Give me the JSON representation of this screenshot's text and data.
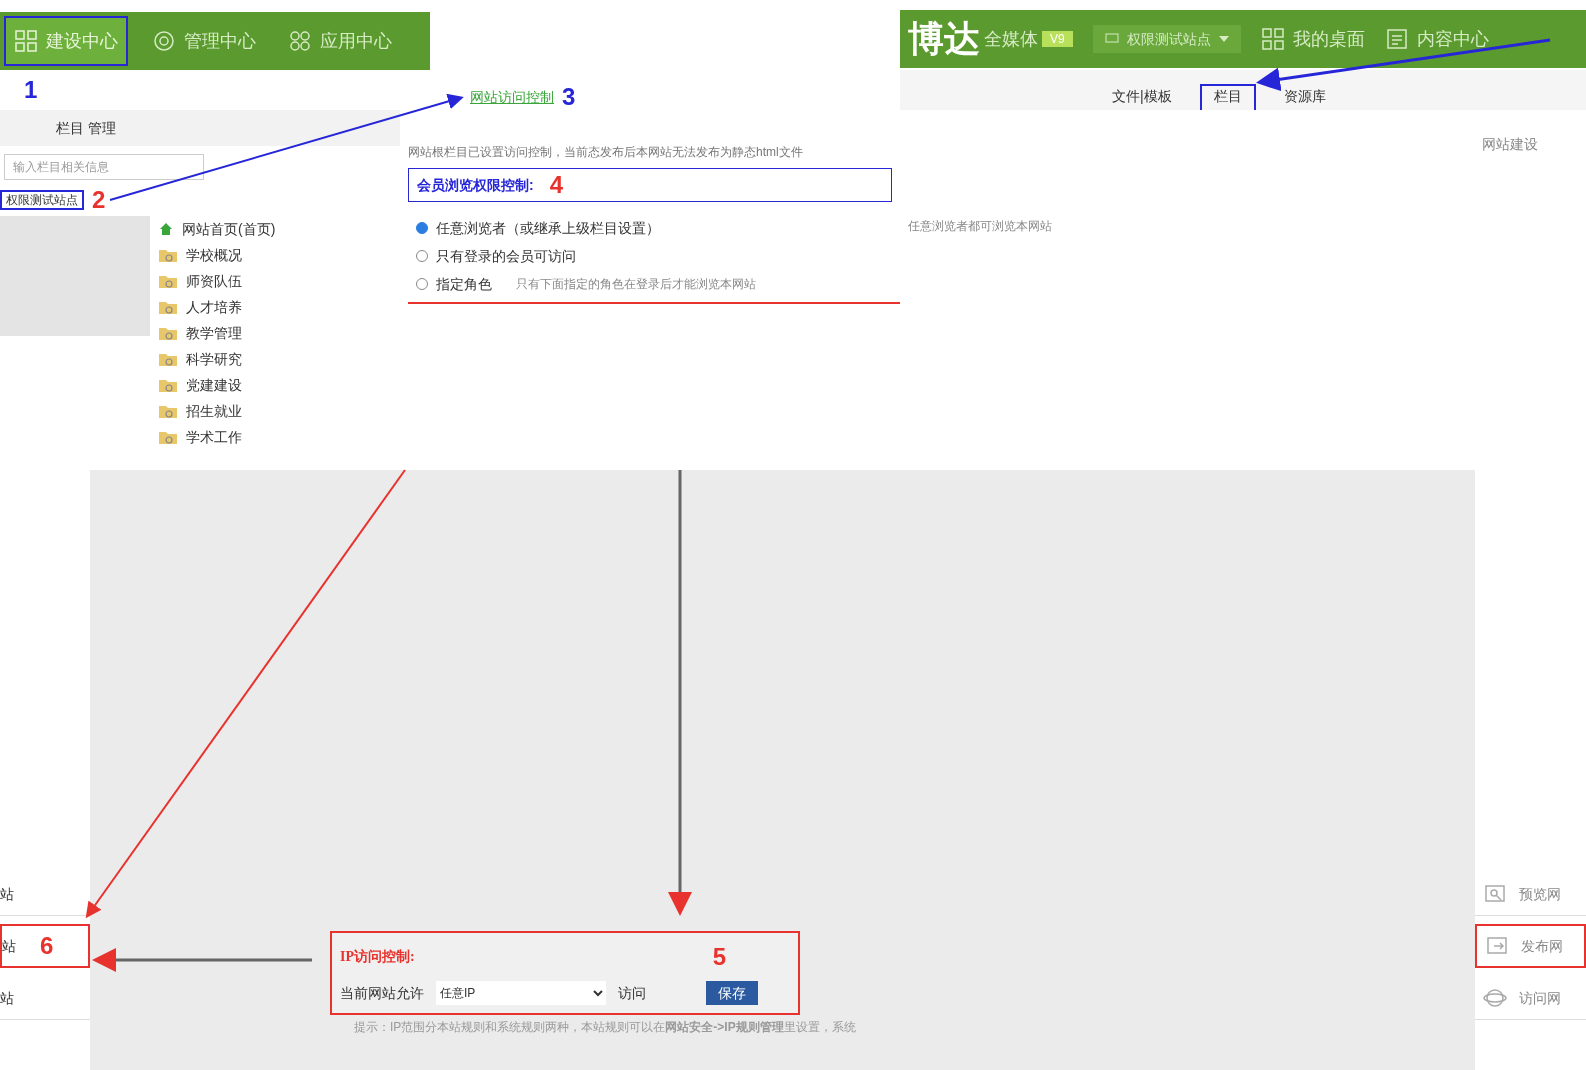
{
  "left_nav": {
    "items": [
      {
        "label": "建设中心",
        "kind": "grid",
        "selected": true
      },
      {
        "label": "管理中心",
        "kind": "gear",
        "selected": false
      },
      {
        "label": "应用中心",
        "kind": "apps",
        "selected": false
      }
    ]
  },
  "header": {
    "logo": "博达",
    "logo_sub": "全媒体",
    "badge": "V9",
    "site_select": "权限测试站点",
    "nav": [
      {
        "label": "我的桌面",
        "kind": "grid"
      },
      {
        "label": "内容中心",
        "kind": "doc"
      }
    ]
  },
  "right_tabs": [
    {
      "label": "文件|模板",
      "selected": false
    },
    {
      "label": "栏目",
      "selected": true
    },
    {
      "label": "资源库",
      "selected": false
    }
  ],
  "site_build": "网站建设",
  "column_panel": {
    "title": "栏目 管理",
    "marker": "1",
    "search_placeholder": "输入栏目相关信息",
    "site": "权限测试站点",
    "site_marker": "2",
    "tree": [
      {
        "label": "网站首页(首页)",
        "kind": "home"
      },
      {
        "label": "学校概况",
        "kind": "folder"
      },
      {
        "label": "师资队伍",
        "kind": "folder"
      },
      {
        "label": "人才培养",
        "kind": "folder"
      },
      {
        "label": "教学管理",
        "kind": "folder"
      },
      {
        "label": "科学研究",
        "kind": "folder"
      },
      {
        "label": "党建建设",
        "kind": "folder"
      },
      {
        "label": "招生就业",
        "kind": "folder"
      },
      {
        "label": "学术工作",
        "kind": "folder"
      }
    ]
  },
  "access": {
    "link": "网站访问控制",
    "link_marker": "3",
    "note": "网站根栏目已设置访问控制，当前态发布后本网站无法发布为静态html文件",
    "heading": "会员浏览权限控制:",
    "marker": "4",
    "options": [
      {
        "label": "任意浏览者（或继承上级栏目设置）",
        "selected": true,
        "hint": "任意浏览者都可浏览本网站"
      },
      {
        "label": "只有登录的会员可访问",
        "selected": false
      },
      {
        "label": "指定角色",
        "selected": false,
        "hint": "只有下面指定的角色在登录后才能浏览本网站"
      }
    ]
  },
  "left_list": [
    {
      "label": "站",
      "highlighted": false
    },
    {
      "label": "站",
      "highlighted": true,
      "marker": "6"
    },
    {
      "label": "站",
      "highlighted": false
    }
  ],
  "ip": {
    "title": "IP访问控制:",
    "marker": "5",
    "prefix": "当前网站允许",
    "select": "任意IP",
    "suffix": "访问",
    "button": "保存",
    "hint": "提示：IP范围分本站规则和系统规则两种，本站规则可以在**网站安全->IP规则管理**里设置，系统"
  },
  "right_list": [
    {
      "label": "预览网",
      "kind": "preview",
      "highlighted": false
    },
    {
      "label": "发布网",
      "kind": "publish",
      "highlighted": true
    },
    {
      "label": "访问网",
      "kind": "globe",
      "highlighted": false
    }
  ]
}
